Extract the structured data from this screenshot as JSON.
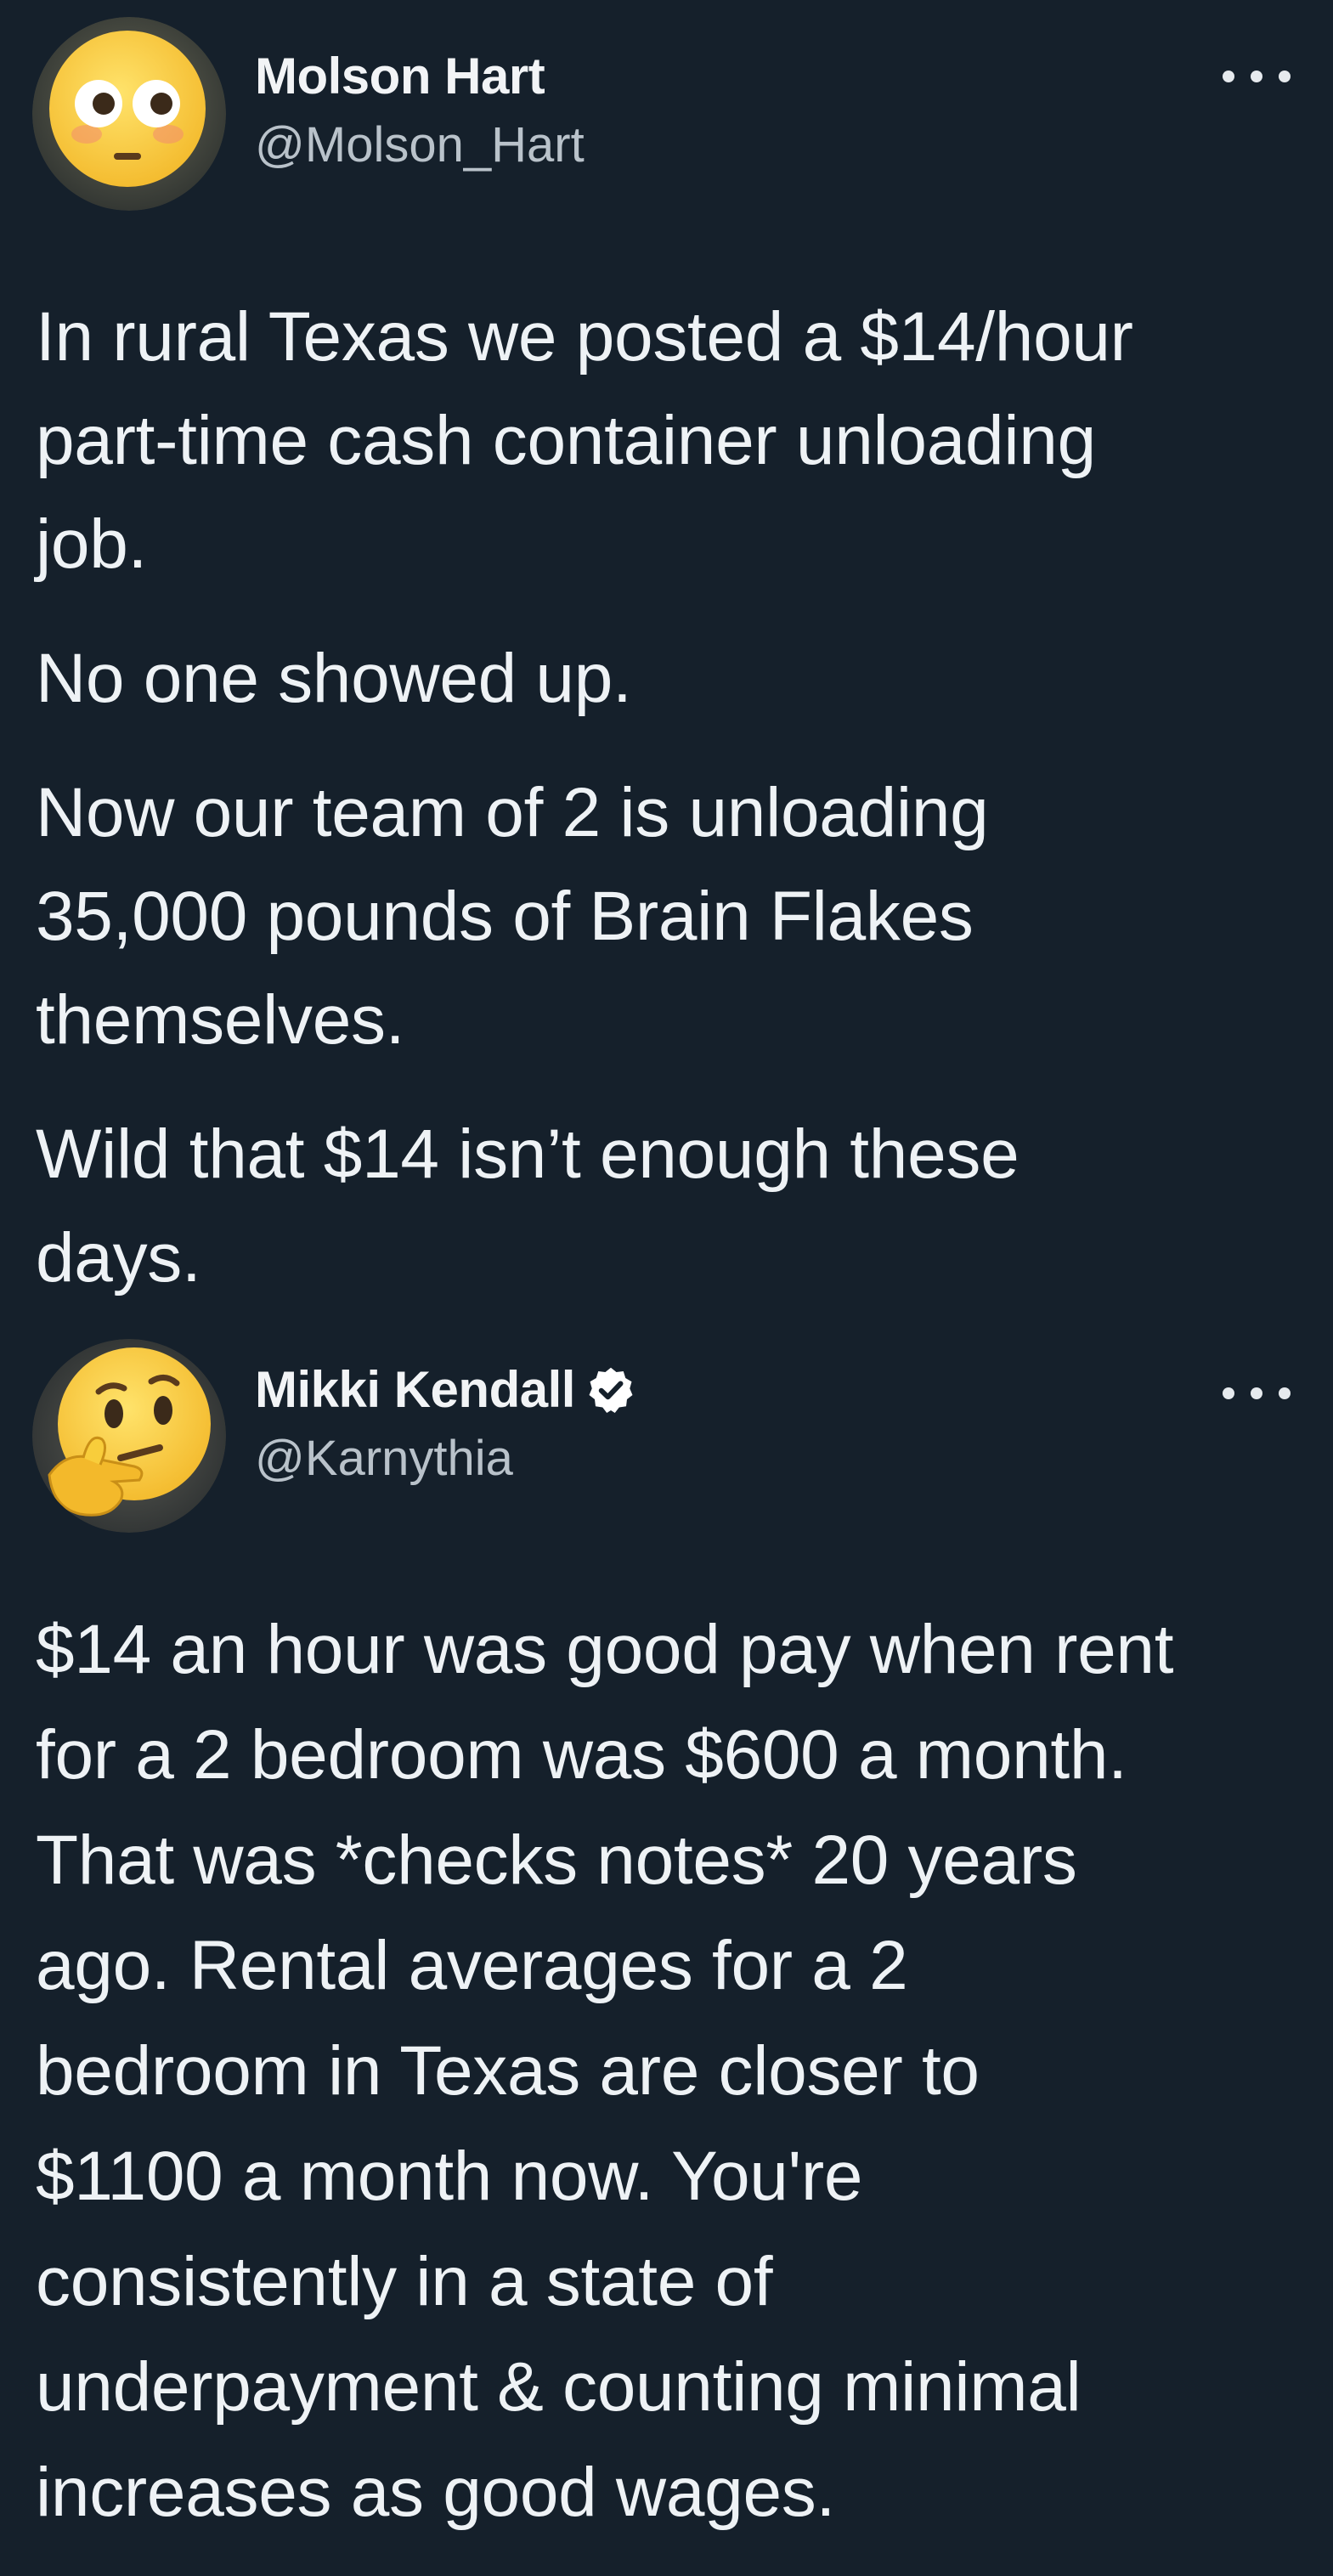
{
  "tweets": [
    {
      "author": {
        "display_name": "Molson Hart",
        "handle": "@Molson_Hart",
        "avatar_icon": "flushed-face-emoji-icon",
        "verified": false
      },
      "paragraphs": [
        "In rural Texas we posted a $14/hour\npart-time cash container unloading\njob.",
        "No one showed up.",
        "Now our team of 2 is unloading\n35,000 pounds of Brain Flakes\nthemselves.",
        "Wild that $14 isn’t enough these\ndays."
      ],
      "more_icon": "ellipsis-icon"
    },
    {
      "author": {
        "display_name": "Mikki Kendall",
        "handle": "@Karnythia",
        "avatar_icon": "thinking-face-emoji-icon",
        "verified": true
      },
      "paragraphs": [
        "$14 an hour was good pay when rent\nfor a 2 bedroom was $600 a month.\nThat was *checks notes* 20 years\nago. Rental averages for a 2\nbedroom in Texas are closer to\n$1100 a month now.  You're\nconsistently in a state of\nunderpayment & counting minimal\nincreases as good wages."
      ],
      "more_icon": "ellipsis-icon"
    }
  ],
  "colors": {
    "background": "#15202b",
    "text_primary": "#eef2f5",
    "text_secondary": "#b9c2ca",
    "verified_badge": "#ffffff",
    "emoji_yellow": "#f8cd3b"
  }
}
